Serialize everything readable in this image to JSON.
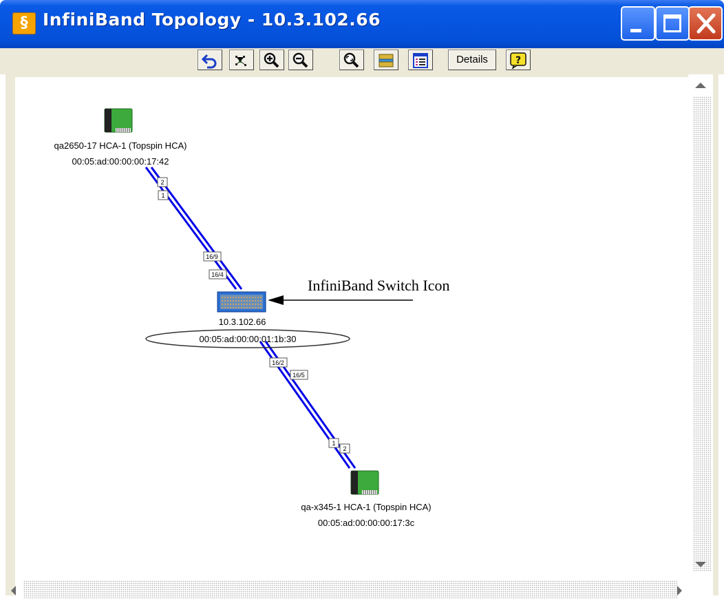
{
  "window": {
    "title": "InfiniBand Topology - 10.3.102.66",
    "app_icon": "topspin-logo-icon",
    "controls": [
      "minimize-icon",
      "maximize-icon",
      "close-icon"
    ]
  },
  "toolbar": {
    "buttons": [
      {
        "icon": "undo-arrow-icon"
      },
      {
        "icon": "fit-layout-icon"
      },
      {
        "icon": "zoom-in-icon"
      },
      {
        "icon": "zoom-out-icon"
      },
      {
        "icon": "zoom-fit-icon"
      },
      {
        "icon": "print-icon"
      },
      {
        "icon": "list-view-icon"
      }
    ],
    "details_label": "Details",
    "help_icon": "help-icon"
  },
  "topology": {
    "nodes": [
      {
        "id": "hca1",
        "name": "qa2650-17 HCA-1 (Topspin HCA)",
        "guid": "00:05:ad:00:00:00:17:42"
      },
      {
        "id": "switch",
        "name": "10.3.102.66",
        "guid": "00:05:ad:00:00:01:1b:30",
        "guid_highlighted": true
      },
      {
        "id": "hca2",
        "name": "qa-x345-1 HCA-1 (Topspin HCA)",
        "guid": "00:05:ad:00:00:00:17:3c"
      }
    ],
    "links": [
      {
        "from": "hca1",
        "to": "switch",
        "port_labels": [
          "2",
          "1",
          "16/9",
          "16/4"
        ]
      },
      {
        "from": "switch",
        "to": "hca2",
        "port_labels": [
          "16/2",
          "16/5",
          "1",
          "2"
        ]
      }
    ],
    "link_color": "#0000e8",
    "hca_color": "#3caa3c"
  },
  "annotation": {
    "label": "InfiniBand Switch Icon"
  }
}
